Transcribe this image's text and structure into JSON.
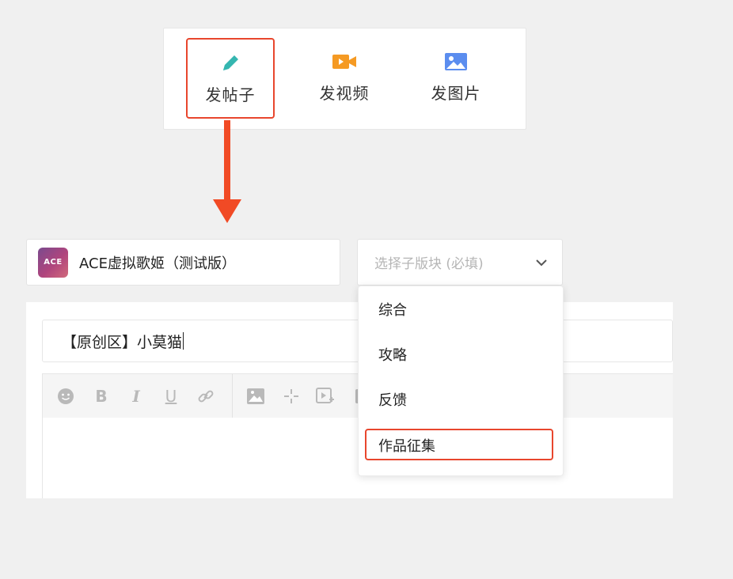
{
  "post_types": [
    {
      "label": "发帖子",
      "icon": "pencil-icon",
      "color": "#35b6b0"
    },
    {
      "label": "发视频",
      "icon": "video-camera-icon",
      "color": "#f59a23"
    },
    {
      "label": "发图片",
      "icon": "image-icon",
      "color": "#5b8def"
    }
  ],
  "forum": {
    "name": "ACE虚拟歌姬（测试版）",
    "logo_text": "ACE",
    "logo_icon": "ace-logo-icon"
  },
  "sub_section": {
    "placeholder": "选择子版块 (必填)",
    "icon": "chevron-down-icon"
  },
  "dropdown": {
    "items": [
      "综合",
      "攻略",
      "反馈",
      "作品征集"
    ],
    "highlighted": "作品征集"
  },
  "editor": {
    "title_value": "【原创区】小莫猫",
    "toolbar": [
      {
        "name": "emoji-icon"
      },
      {
        "name": "bold-icon",
        "glyph": "B"
      },
      {
        "name": "italic-icon",
        "glyph": "I"
      },
      {
        "name": "underline-icon",
        "glyph": "U"
      },
      {
        "name": "link-icon"
      },
      {
        "name": "insert-image-icon"
      },
      {
        "name": "move-icon"
      },
      {
        "name": "insert-video-icon"
      }
    ]
  },
  "colors": {
    "accent": "#e8462d",
    "arrow": "#f14a25",
    "background": "#f0f0f0"
  }
}
